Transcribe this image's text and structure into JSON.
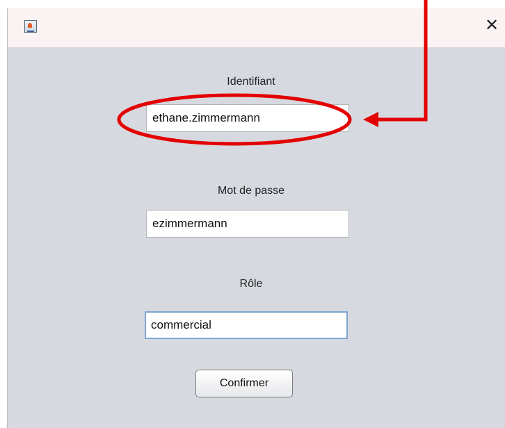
{
  "window": {
    "icon": "java-cup-icon",
    "close_glyph": "✕"
  },
  "form": {
    "identifiant_label": "Identifiant",
    "identifiant_value": "ethane.zimmermann",
    "password_label": "Mot de passe",
    "password_value": "ezimmermann",
    "role_label": "Rôle",
    "role_value": "commercial",
    "confirm_label": "Confirmer"
  },
  "annotation": {
    "color": "#e30000",
    "shapes": [
      "ellipse-highlight",
      "arrow-pointer"
    ]
  }
}
